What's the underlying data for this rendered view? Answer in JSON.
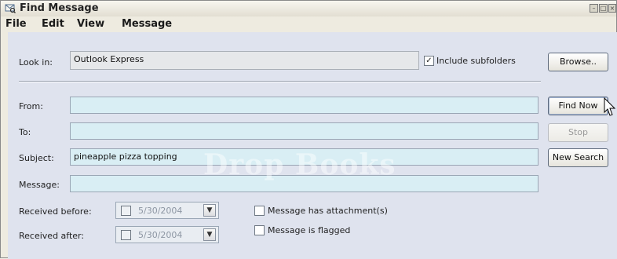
{
  "window": {
    "title": "Find Message"
  },
  "menu": [
    "File",
    "Edit",
    "View",
    "Message"
  ],
  "lookin": {
    "label": "Look in:",
    "value": "Outlook Express",
    "include_subfolders_label": "Include subfolders",
    "include_subfolders_checked": true
  },
  "buttons": {
    "browse": "Browse..",
    "find_now": "Find Now",
    "stop": "Stop",
    "new_search": "New Search"
  },
  "fields": {
    "from": {
      "label": "From:",
      "value": ""
    },
    "to": {
      "label": "To:",
      "value": ""
    },
    "subject": {
      "label": "Subject:",
      "value": "pineapple pizza topping"
    },
    "message": {
      "label": "Message:",
      "value": ""
    }
  },
  "received_before": {
    "label": "Received before:",
    "date": "5/30/2004",
    "checked": false
  },
  "received_after": {
    "label": "Received after:",
    "date": "5/30/2004",
    "checked": false
  },
  "options": {
    "attachment_label": "Message has attachment(s)",
    "flagged_label": "Message is flagged"
  },
  "watermark": "Drop Books",
  "icons": {
    "window": "find-message-icon",
    "minimize": "minimize-icon",
    "maximize": "maximize-icon",
    "close": "close-icon",
    "dropdown": "chevron-down-icon",
    "cursor": "mouse-pointer-icon"
  }
}
